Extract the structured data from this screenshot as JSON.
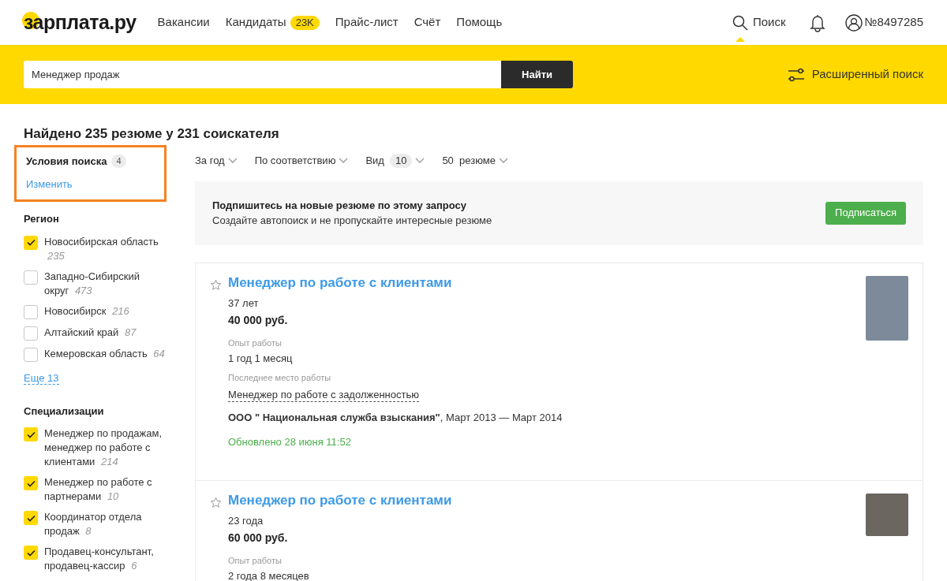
{
  "header": {
    "logo": "зарплата.ру",
    "nav": [
      {
        "label": "Вакансии"
      },
      {
        "label": "Кандидаты",
        "badge": "23K"
      },
      {
        "label": "Прайс-лист"
      },
      {
        "label": "Счёт"
      },
      {
        "label": "Помощь"
      }
    ],
    "search_link": {
      "label": "Поиск",
      "selected": true
    },
    "account": "№8497285"
  },
  "search_bar": {
    "value": "Менеджер продаж",
    "button": "Найти",
    "advanced": "Расширенный поиск"
  },
  "results_title": "Найдено 235 резюме у 231 соискателя",
  "sidebar": {
    "conditions": {
      "title": "Условия поиска",
      "count": "4",
      "link": "Изменить",
      "highlighted": true
    },
    "groups": [
      {
        "title": "Регион",
        "items": [
          {
            "label": "Новосибирская область",
            "count": "235",
            "checked": true
          },
          {
            "label": "Западно-Сибирский округ",
            "count": "473",
            "checked": false
          },
          {
            "label": "Новосибирск",
            "count": "216",
            "checked": false
          },
          {
            "label": "Алтайский край",
            "count": "87",
            "checked": false
          },
          {
            "label": "Кемеровская область",
            "count": "64",
            "checked": false
          }
        ],
        "more": "Еще 13"
      },
      {
        "title": "Специализации",
        "items": [
          {
            "label": "Менеджер по продажам, менеджер по работе с клиентами",
            "count": "214",
            "checked": true
          },
          {
            "label": "Менеджер по работе с партнерами",
            "count": "10",
            "checked": true
          },
          {
            "label": "Координатор отдела продаж",
            "count": "8",
            "checked": true
          },
          {
            "label": "Продавец-консультант, продавец-кассир",
            "count": "6",
            "checked": true
          }
        ]
      }
    ]
  },
  "filters": [
    {
      "label": "За год"
    },
    {
      "label": "По соответствию"
    },
    {
      "label": "Вид",
      "badge": "10"
    },
    {
      "label": "50  резюме"
    }
  ],
  "subscribe": {
    "title": "Подпишитесь на новые резюме по этому запросу",
    "text": "Создайте автопоиск и не пропускайте интересные резюме",
    "button": "Подписаться"
  },
  "resumes": [
    {
      "title": "Менеджер по работе с клиентами",
      "age": "37 лет",
      "salary": "40 000 руб.",
      "experience_label": "Опыт работы",
      "experience": "1 год 1 месяц",
      "last_job_label": "Последнее место работы",
      "last_job": "Менеджер по работе с задолженностью",
      "company": "**ООО \" Национальная служба взыскания\"**, Март 2013 — Март 2014",
      "updated": "Обновлено 28 июня 11:52",
      "kind": "portrait"
    },
    {
      "title": "Менеджер по работе с клиентами",
      "age": "23 года",
      "salary": "60 000 руб.",
      "experience_label": "Опыт работы",
      "experience": "2 года 8 месяцев",
      "kind": "square"
    }
  ]
}
